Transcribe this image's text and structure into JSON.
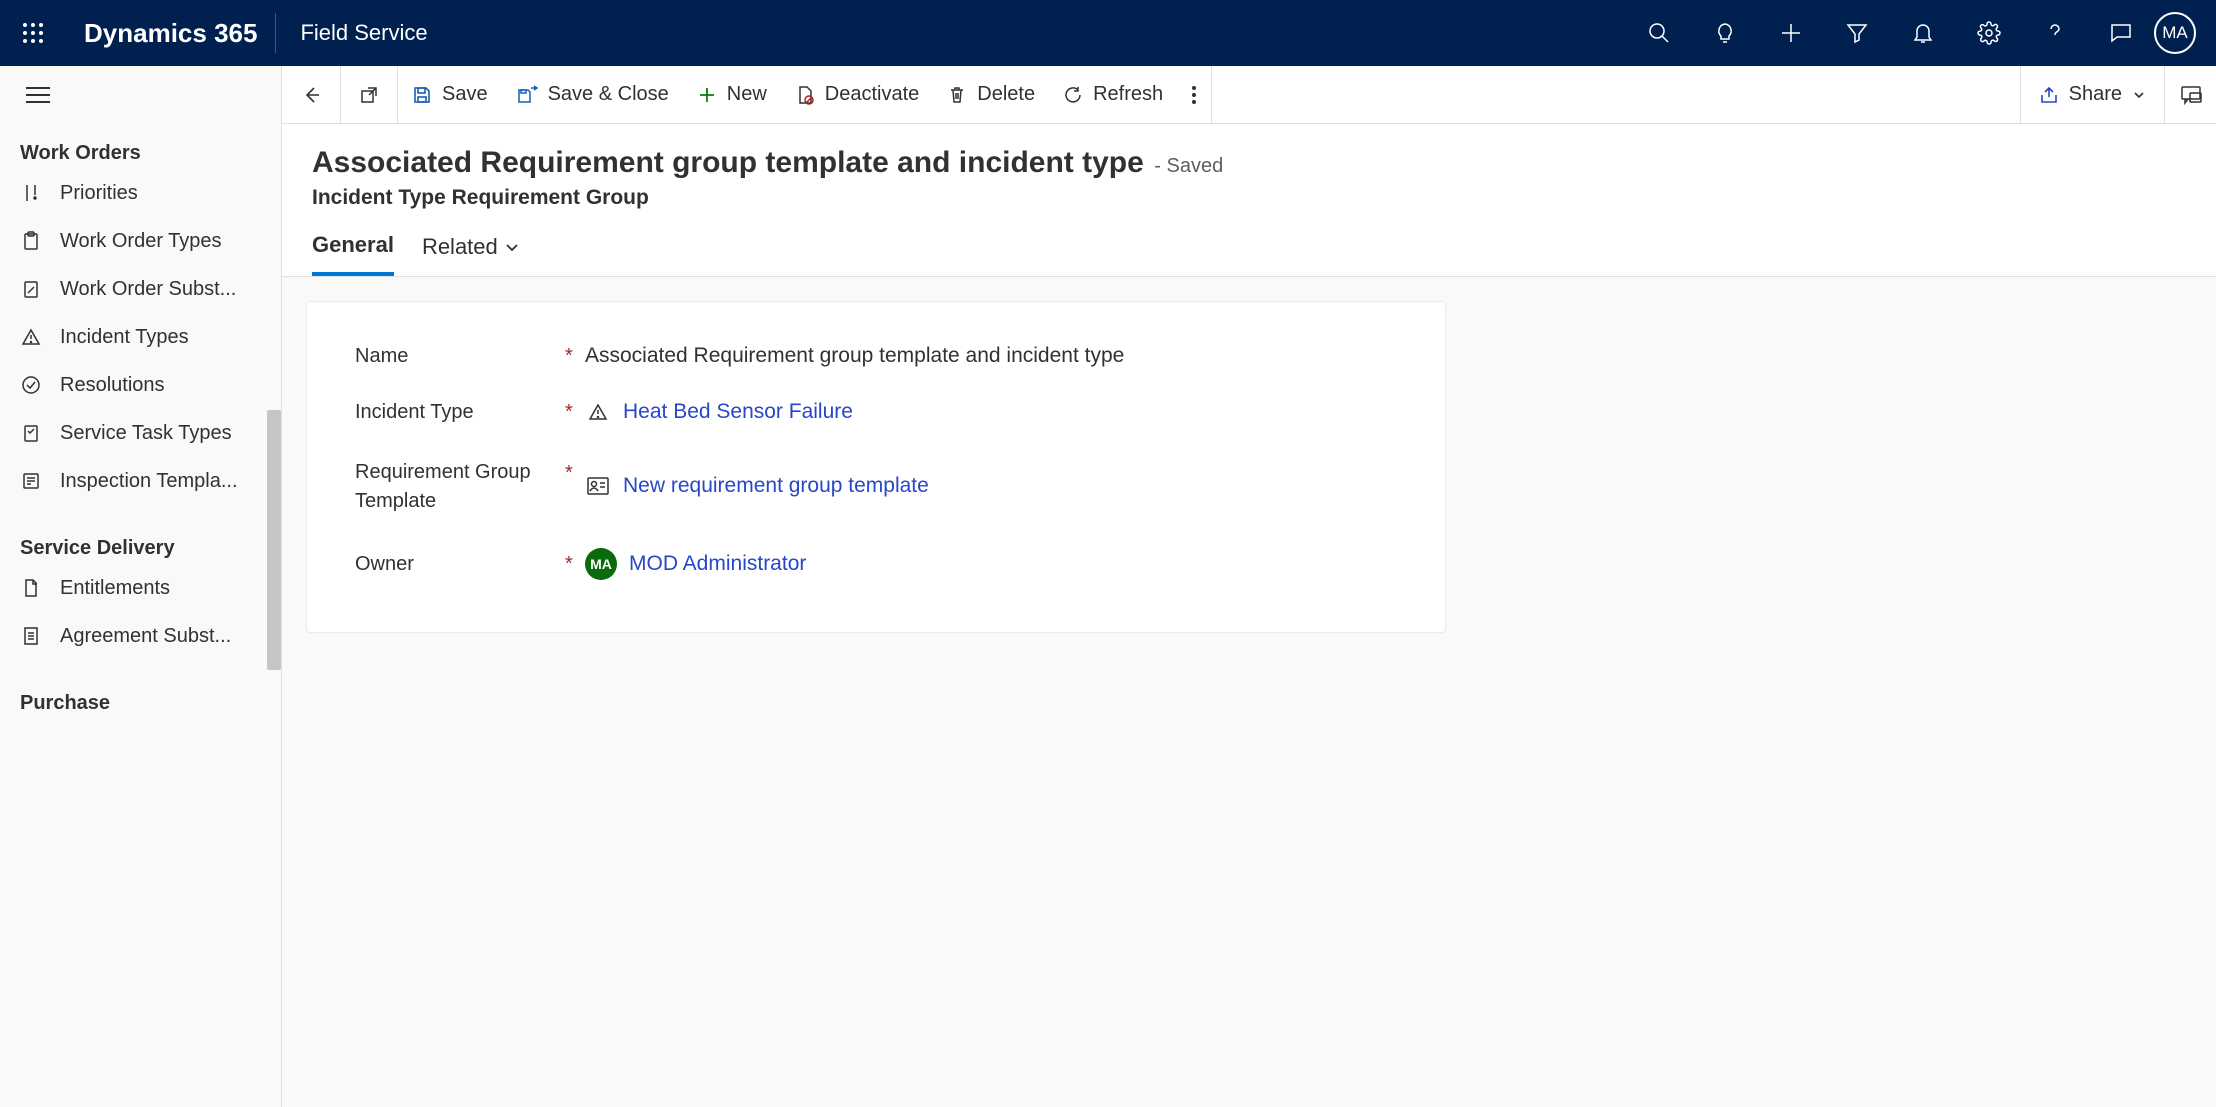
{
  "brand": "Dynamics 365",
  "module": "Field Service",
  "user_initials": "MA",
  "sidebar": {
    "section1": "Work Orders",
    "items1": [
      {
        "label": "Priorities"
      },
      {
        "label": "Work Order Types"
      },
      {
        "label": "Work Order Subst..."
      },
      {
        "label": "Incident Types"
      },
      {
        "label": "Resolutions"
      },
      {
        "label": "Service Task Types"
      },
      {
        "label": "Inspection Templa..."
      }
    ],
    "section2": "Service Delivery",
    "items2": [
      {
        "label": "Entitlements"
      },
      {
        "label": "Agreement Subst..."
      }
    ],
    "section3": "Purchase"
  },
  "cmd": {
    "save": "Save",
    "save_close": "Save & Close",
    "new": "New",
    "deactivate": "Deactivate",
    "delete": "Delete",
    "refresh": "Refresh",
    "share": "Share"
  },
  "page": {
    "title": "Associated Requirement group template and incident type",
    "status": "- Saved",
    "subtitle": "Incident Type Requirement Group",
    "tab_general": "General",
    "tab_related": "Related"
  },
  "form": {
    "name_label": "Name",
    "name_value": "Associated Requirement group template and incident type",
    "incident_label": "Incident Type",
    "incident_value": "Heat Bed Sensor Failure",
    "reqgroup_label": "Requirement Group Template",
    "reqgroup_value": "New requirement group template",
    "owner_label": "Owner",
    "owner_initials": "MA",
    "owner_value": "MOD Administrator"
  }
}
